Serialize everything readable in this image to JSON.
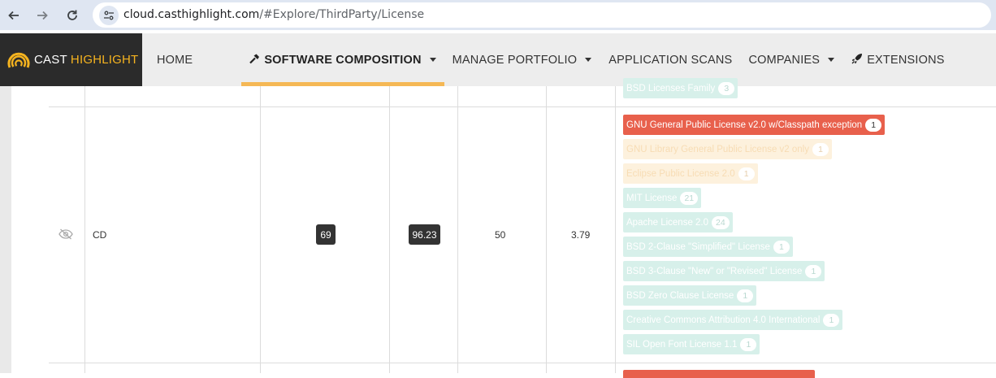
{
  "browser": {
    "url_host": "cloud.casthighlight.com",
    "url_path": "/#Explore/ThirdParty/License"
  },
  "app": {
    "logo": {
      "word1": "CAST",
      "word2": "HIGHLIGHT"
    },
    "menu": [
      {
        "label": "HOME"
      },
      {
        "label": "SOFTWARE COMPOSITION",
        "active": true
      },
      {
        "label": "MANAGE PORTFOLIO"
      },
      {
        "label": "APPLICATION SCANS"
      },
      {
        "label": "COMPANIES"
      },
      {
        "label": "EXTENSIONS"
      }
    ]
  },
  "table": {
    "prev_row_license": {
      "name": "BSD Licenses Family",
      "count": "3"
    },
    "row": {
      "name": "CD",
      "badge1": "69",
      "badge2": "96.23",
      "value1": "50",
      "value2": "3.79",
      "licenses": [
        {
          "name": "GNU General Public License v2.0 w/Classpath exception",
          "count": "1",
          "level": "high"
        },
        {
          "name": "GNU Library General Public License v2 only",
          "count": "1",
          "level": "medium"
        },
        {
          "name": "Eclipse Public License 2.0",
          "count": "1",
          "level": "medium"
        },
        {
          "name": "MIT License",
          "count": "21",
          "level": "low"
        },
        {
          "name": "Apache License 2.0",
          "count": "24",
          "level": "low"
        },
        {
          "name": "BSD 2-Clause \"Simplified\" License",
          "count": "1",
          "level": "low"
        },
        {
          "name": "BSD 3-Clause \"New\" or \"Revised\" License",
          "count": "1",
          "level": "low"
        },
        {
          "name": "BSD Zero Clause License",
          "count": "1",
          "level": "low"
        },
        {
          "name": "Creative Commons Attribution 4.0 International",
          "count": "1",
          "level": "low"
        },
        {
          "name": "SIL Open Font License 1.1",
          "count": "1",
          "level": "low"
        }
      ]
    }
  },
  "colors": {
    "high": "#e8604c",
    "medium": "#fdf1dd",
    "low": "#d7f0ea",
    "brand_accent": "#f5b31f"
  }
}
